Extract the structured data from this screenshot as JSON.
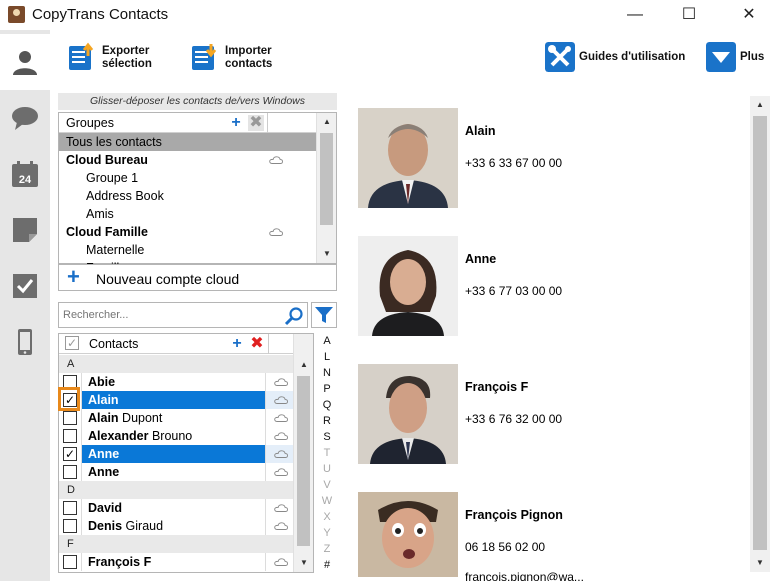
{
  "app": {
    "title": "CopyTrans Contacts",
    "window_controls": {
      "minimize": "—",
      "maximize": "☐",
      "close": "✕"
    }
  },
  "rail": {
    "items": [
      {
        "icon": "person-icon",
        "active": true
      },
      {
        "icon": "chat-icon",
        "active": false
      },
      {
        "icon": "calendar-icon",
        "label": "24",
        "active": false
      },
      {
        "icon": "note-icon",
        "active": false
      },
      {
        "icon": "task-check-icon",
        "active": false
      },
      {
        "icon": "phone-icon",
        "active": false
      }
    ]
  },
  "toolbar": {
    "export_line1": "Exporter",
    "export_line2": "sélection",
    "import_line1": "Importer",
    "import_line2": "contacts",
    "guides_label": "Guides d'utilisation",
    "more_label": "Plus"
  },
  "groups": {
    "drag_hint": "Glisser-déposer les contacts de/vers Windows",
    "header": "Groupes",
    "rows": [
      {
        "label": "Tous les contacts",
        "level": 0,
        "bold": false,
        "selected": true,
        "cloud": false
      },
      {
        "label": "Cloud Bureau",
        "level": 0,
        "bold": true,
        "selected": false,
        "cloud": true
      },
      {
        "label": "Groupe 1",
        "level": 1,
        "bold": false,
        "selected": false,
        "cloud": false
      },
      {
        "label": "Address Book",
        "level": 1,
        "bold": false,
        "selected": false,
        "cloud": false
      },
      {
        "label": "Amis",
        "level": 1,
        "bold": false,
        "selected": false,
        "cloud": false
      },
      {
        "label": "Cloud Famille",
        "level": 0,
        "bold": true,
        "selected": false,
        "cloud": true
      },
      {
        "label": "Maternelle",
        "level": 1,
        "bold": false,
        "selected": false,
        "cloud": false
      },
      {
        "label": "Famille",
        "level": 1,
        "bold": false,
        "selected": false,
        "cloud": false
      }
    ],
    "new_cloud_label": "Nouveau compte cloud"
  },
  "search": {
    "placeholder": "Rechercher..."
  },
  "contacts": {
    "header": "Contacts",
    "rows": [
      {
        "type": "section",
        "label": "A"
      },
      {
        "type": "contact",
        "first": "Abie",
        "last": "",
        "checked": false,
        "selected": false
      },
      {
        "type": "contact",
        "first": "Alain",
        "last": "",
        "checked": true,
        "selected": true
      },
      {
        "type": "contact",
        "first": "Alain",
        "last": "Dupont",
        "checked": false,
        "selected": false
      },
      {
        "type": "contact",
        "first": "Alexander",
        "last": "Brouno",
        "checked": false,
        "selected": false
      },
      {
        "type": "contact",
        "first": "Anne",
        "last": "",
        "checked": true,
        "selected": true
      },
      {
        "type": "contact",
        "first": "Anne",
        "last": "",
        "checked": false,
        "selected": false
      },
      {
        "type": "section",
        "label": "D"
      },
      {
        "type": "contact",
        "first": "David",
        "last": "",
        "checked": false,
        "selected": false
      },
      {
        "type": "contact",
        "first": "Denis",
        "last": "Giraud",
        "checked": false,
        "selected": false
      },
      {
        "type": "section",
        "label": "F"
      },
      {
        "type": "contact",
        "first": "François F",
        "last": "",
        "checked": false,
        "selected": false
      }
    ],
    "alphabet": [
      {
        "letter": "A",
        "enabled": true
      },
      {
        "letter": "L",
        "enabled": true
      },
      {
        "letter": "N",
        "enabled": true
      },
      {
        "letter": "P",
        "enabled": true
      },
      {
        "letter": "Q",
        "enabled": true
      },
      {
        "letter": "R",
        "enabled": true
      },
      {
        "letter": "S",
        "enabled": true
      },
      {
        "letter": "T",
        "enabled": false
      },
      {
        "letter": "U",
        "enabled": false
      },
      {
        "letter": "V",
        "enabled": false
      },
      {
        "letter": "W",
        "enabled": false
      },
      {
        "letter": "X",
        "enabled": false
      },
      {
        "letter": "Y",
        "enabled": false
      },
      {
        "letter": "Z",
        "enabled": false
      },
      {
        "letter": "#",
        "enabled": true
      }
    ]
  },
  "details": {
    "cards": [
      {
        "name": "Alain",
        "phone": "+33 6 33 67 00 00",
        "email": ""
      },
      {
        "name": "Anne",
        "phone": "+33 6 77 03 00 00",
        "email": ""
      },
      {
        "name": "François F",
        "phone": "+33 6 76 32 00 00",
        "email": ""
      },
      {
        "name": "François Pignon",
        "phone": "06 18 56 02 00",
        "email": "francois.pignon@wa..."
      }
    ]
  },
  "colors": {
    "accent": "#0a78d7",
    "selected_group": "#a9a9a9",
    "highlight": "#e8891b",
    "rail_bg": "#e6e6e6"
  }
}
